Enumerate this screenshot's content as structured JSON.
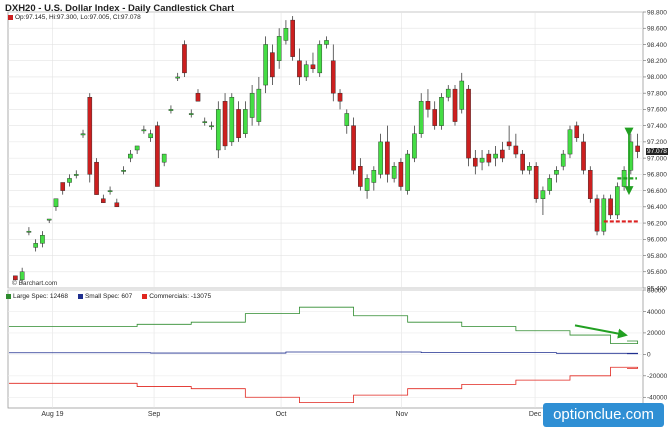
{
  "title": "DXH20 - U.S. Dollar Index - Daily Candlestick Chart",
  "ohlc_label": "Op:97.145, Hi:97.300, Lo:97.005, Cl:97.078",
  "price_tag": "97.078",
  "credit": "© Barchart.com",
  "watermark": "optionclue.com",
  "cot_legend": [
    {
      "label": "Large Spec: 12468",
      "color": "#2e8b2e"
    },
    {
      "label": "Small Spec: 607",
      "color": "#1f2f8f"
    },
    {
      "label": "Commercials: -13075",
      "color": "#e0261f"
    }
  ],
  "colors": {
    "up": "#44dd44",
    "down": "#cc1f1f",
    "arrow": "#22a022",
    "support": "#dd2020"
  },
  "chart_data": [
    {
      "type": "candlestick",
      "title": "DXH20 - U.S. Dollar Index - Daily Candlestick Chart",
      "x_labels": [
        "Aug 19",
        "Sep",
        "Oct",
        "Nov",
        "Dec"
      ],
      "ylim": [
        95.4,
        98.8
      ],
      "y_ticks": [
        "95.400",
        "95.600",
        "95.800",
        "96.000",
        "96.200",
        "96.400",
        "96.600",
        "96.800",
        "97.000",
        "97.200",
        "97.400",
        "97.600",
        "97.800",
        "98.000",
        "98.200",
        "98.400",
        "98.600",
        "98.800"
      ],
      "grid": true,
      "candles": [
        [
          95.55,
          95.55,
          95.5,
          95.5
        ],
        [
          95.5,
          95.65,
          95.45,
          95.6
        ],
        [
          96.1,
          96.15,
          96.05,
          96.1
        ],
        [
          95.9,
          96.0,
          95.85,
          95.95
        ],
        [
          95.95,
          96.1,
          95.9,
          96.05
        ],
        [
          96.25,
          96.25,
          96.2,
          96.25
        ],
        [
          96.4,
          96.5,
          96.35,
          96.5
        ],
        [
          96.7,
          96.7,
          96.55,
          96.6
        ],
        [
          96.7,
          96.8,
          96.65,
          96.75
        ],
        [
          96.8,
          96.85,
          96.75,
          96.8
        ],
        [
          97.3,
          97.35,
          97.25,
          97.3
        ],
        [
          97.75,
          97.8,
          96.7,
          96.8
        ],
        [
          96.95,
          97.0,
          96.55,
          96.55
        ],
        [
          96.5,
          96.55,
          96.45,
          96.45
        ],
        [
          96.6,
          96.65,
          96.55,
          96.6
        ],
        [
          96.45,
          96.5,
          96.4,
          96.4
        ],
        [
          96.85,
          96.9,
          96.8,
          96.85
        ],
        [
          97.0,
          97.1,
          96.95,
          97.05
        ],
        [
          97.1,
          97.15,
          97.05,
          97.15
        ],
        [
          97.35,
          97.4,
          97.3,
          97.35
        ],
        [
          97.25,
          97.35,
          97.2,
          97.3
        ],
        [
          97.4,
          97.45,
          96.65,
          96.65
        ],
        [
          96.95,
          97.05,
          96.9,
          97.05
        ],
        [
          97.6,
          97.65,
          97.55,
          97.6
        ],
        [
          98.0,
          98.05,
          97.95,
          98.0
        ],
        [
          98.4,
          98.45,
          98.0,
          98.05
        ],
        [
          97.55,
          97.6,
          97.5,
          97.55
        ],
        [
          97.8,
          97.85,
          97.7,
          97.7
        ],
        [
          97.45,
          97.5,
          97.4,
          97.45
        ],
        [
          97.4,
          97.45,
          97.35,
          97.4
        ],
        [
          97.1,
          97.7,
          97.0,
          97.6
        ],
        [
          97.7,
          97.8,
          97.1,
          97.15
        ],
        [
          97.2,
          97.8,
          97.15,
          97.75
        ],
        [
          97.6,
          97.7,
          97.2,
          97.25
        ],
        [
          97.3,
          97.7,
          97.25,
          97.6
        ],
        [
          97.5,
          97.9,
          97.4,
          97.8
        ],
        [
          97.45,
          98.0,
          97.4,
          97.85
        ],
        [
          97.9,
          98.5,
          97.8,
          98.4
        ],
        [
          98.3,
          98.4,
          97.9,
          98.0
        ],
        [
          98.2,
          98.6,
          98.1,
          98.5
        ],
        [
          98.45,
          98.7,
          98.4,
          98.6
        ],
        [
          98.7,
          98.75,
          98.2,
          98.25
        ],
        [
          98.2,
          98.35,
          97.9,
          98.0
        ],
        [
          98.0,
          98.2,
          97.95,
          98.15
        ],
        [
          98.15,
          98.3,
          98.05,
          98.1
        ],
        [
          98.05,
          98.45,
          98.0,
          98.4
        ],
        [
          98.4,
          98.5,
          98.35,
          98.45
        ],
        [
          98.2,
          98.4,
          97.7,
          97.8
        ],
        [
          97.8,
          97.85,
          97.6,
          97.7
        ],
        [
          97.4,
          97.6,
          97.3,
          97.55
        ],
        [
          97.4,
          97.5,
          96.8,
          96.85
        ],
        [
          96.9,
          97.0,
          96.6,
          96.65
        ],
        [
          96.6,
          96.8,
          96.5,
          96.75
        ],
        [
          96.7,
          96.9,
          96.6,
          96.85
        ],
        [
          96.8,
          97.3,
          96.75,
          97.2
        ],
        [
          97.2,
          97.4,
          96.7,
          96.8
        ],
        [
          96.75,
          96.95,
          96.7,
          96.9
        ],
        [
          96.95,
          97.0,
          96.6,
          96.65
        ],
        [
          96.6,
          97.1,
          96.55,
          97.05
        ],
        [
          97.0,
          97.4,
          96.95,
          97.3
        ],
        [
          97.3,
          97.8,
          97.25,
          97.7
        ],
        [
          97.7,
          97.85,
          97.5,
          97.6
        ],
        [
          97.6,
          97.7,
          97.35,
          97.4
        ],
        [
          97.4,
          97.8,
          97.35,
          97.75
        ],
        [
          97.75,
          97.9,
          97.7,
          97.85
        ],
        [
          97.85,
          97.9,
          97.4,
          97.45
        ],
        [
          97.6,
          98.05,
          97.55,
          97.95
        ],
        [
          97.85,
          97.9,
          96.9,
          97.0
        ],
        [
          97.0,
          97.1,
          96.8,
          96.9
        ],
        [
          96.95,
          97.1,
          96.85,
          97.0
        ],
        [
          97.05,
          97.1,
          96.9,
          96.95
        ],
        [
          97.0,
          97.15,
          96.9,
          97.05
        ],
        [
          97.1,
          97.2,
          96.95,
          97.0
        ],
        [
          97.2,
          97.4,
          97.1,
          97.15
        ],
        [
          97.15,
          97.3,
          97.0,
          97.05
        ],
        [
          97.05,
          97.1,
          96.8,
          96.85
        ],
        [
          96.85,
          96.95,
          96.8,
          96.9
        ],
        [
          96.9,
          96.95,
          96.45,
          96.5
        ],
        [
          96.5,
          96.65,
          96.3,
          96.6
        ],
        [
          96.6,
          96.8,
          96.55,
          96.75
        ],
        [
          96.8,
          96.9,
          96.7,
          96.85
        ],
        [
          96.9,
          97.1,
          96.85,
          97.05
        ],
        [
          97.05,
          97.4,
          97.0,
          97.35
        ],
        [
          97.4,
          97.45,
          97.2,
          97.25
        ],
        [
          97.2,
          97.3,
          96.8,
          96.85
        ],
        [
          96.85,
          96.9,
          96.45,
          96.5
        ],
        [
          96.5,
          96.55,
          96.05,
          96.1
        ],
        [
          96.1,
          96.55,
          96.05,
          96.5
        ],
        [
          96.5,
          96.55,
          96.25,
          96.3
        ],
        [
          96.3,
          96.7,
          96.25,
          96.65
        ],
        [
          96.65,
          96.9,
          96.6,
          96.85
        ],
        [
          96.85,
          97.3,
          96.8,
          97.2
        ],
        [
          97.15,
          97.3,
          97.0,
          97.08
        ]
      ]
    },
    {
      "type": "line",
      "title": "COT",
      "ylim": [
        -50000,
        60000
      ],
      "y_ticks": [
        "60000",
        "40000",
        "20000",
        "0",
        "-20000",
        "-40000"
      ],
      "series": [
        {
          "name": "Large Spec",
          "color": "#2e8b2e",
          "x": [
            0,
            18,
            26,
            34,
            42,
            50,
            58,
            66,
            74,
            82,
            88,
            94
          ],
          "y": [
            26000,
            28000,
            30000,
            38000,
            44000,
            36000,
            30000,
            26000,
            22000,
            18000,
            10000,
            12468
          ]
        },
        {
          "name": "Small Spec",
          "color": "#1f2f8f",
          "x": [
            0,
            20,
            40,
            60,
            80,
            94
          ],
          "y": [
            1500,
            1200,
            2200,
            1600,
            1000,
            607
          ]
        },
        {
          "name": "Commercials",
          "color": "#e0261f",
          "x": [
            0,
            18,
            26,
            34,
            42,
            50,
            58,
            66,
            74,
            82,
            88,
            94
          ],
          "y": [
            -27000,
            -30000,
            -32000,
            -40000,
            -45000,
            -38000,
            -32000,
            -28000,
            -24000,
            -20000,
            -12000,
            -13075
          ]
        }
      ]
    }
  ]
}
